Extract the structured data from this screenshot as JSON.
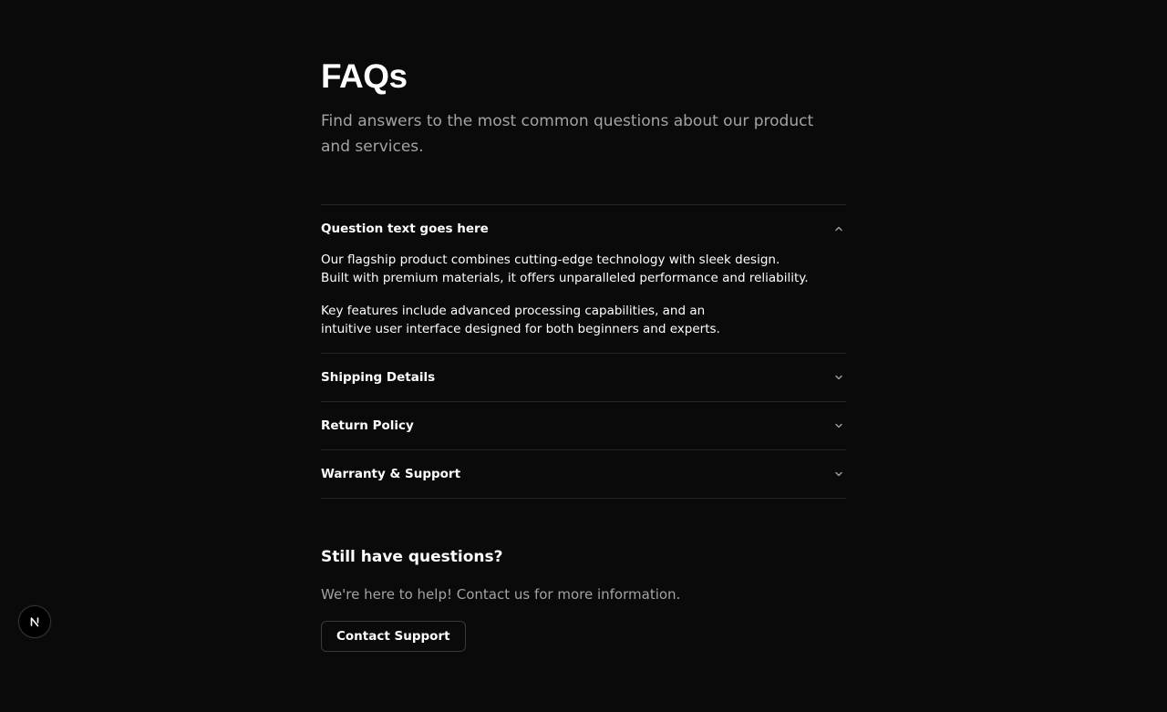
{
  "header": {
    "title": "FAQs",
    "subtitle": "Find answers to the most common questions about our product and services."
  },
  "faq": {
    "items": [
      {
        "question": "Question text goes here",
        "expanded": true,
        "answer": [
          "Our flagship product combines cutting-edge technology with sleek design.\nBuilt with premium materials, it offers unparalleled performance and reliability.",
          "Key features include advanced processing capabilities, and an\nintuitive user interface designed for both beginners and experts."
        ]
      },
      {
        "question": "Shipping Details",
        "expanded": false
      },
      {
        "question": "Return Policy",
        "expanded": false
      },
      {
        "question": "Warranty & Support",
        "expanded": false
      }
    ]
  },
  "help": {
    "heading": "Still have questions?",
    "text": "We're here to help! Contact us for more information.",
    "button_label": "Contact Support"
  },
  "icons": {
    "expanded": "chevron-up-icon",
    "collapsed": "chevron-down-icon",
    "badge": "nextjs-logo-icon"
  },
  "colors": {
    "background": "#0a0a0a",
    "text": "#ffffff",
    "muted": "#a3a3a3",
    "border": "#262626"
  }
}
